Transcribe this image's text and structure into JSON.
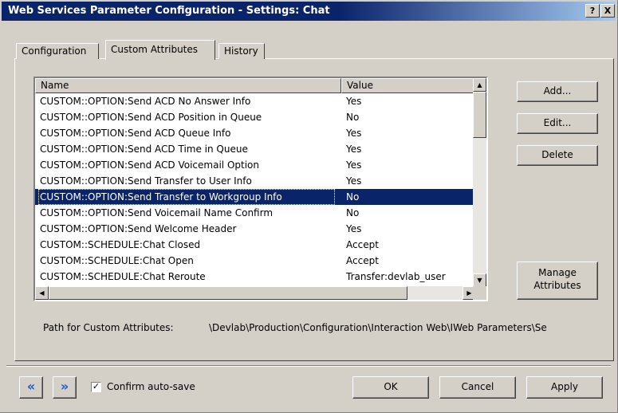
{
  "window": {
    "title": "Web Services Parameter Configuration - Settings: Chat",
    "help_label": "?",
    "close_label": "X"
  },
  "tabs": [
    {
      "label": "Configuration",
      "active": false
    },
    {
      "label": "Custom Attributes",
      "active": true
    },
    {
      "label": "History",
      "active": false
    }
  ],
  "list": {
    "columns": [
      "Name",
      "Value"
    ],
    "rows": [
      {
        "name": "CUSTOM::OPTION:Send ACD No Answer Info",
        "value": "Yes"
      },
      {
        "name": "CUSTOM::OPTION:Send ACD Position in Queue",
        "value": "No"
      },
      {
        "name": "CUSTOM::OPTION:Send ACD Queue Info",
        "value": "Yes"
      },
      {
        "name": "CUSTOM::OPTION:Send ACD Time in Queue",
        "value": "Yes"
      },
      {
        "name": "CUSTOM::OPTION:Send ACD Voicemail Option",
        "value": "Yes"
      },
      {
        "name": "CUSTOM::OPTION:Send Transfer to User Info",
        "value": "Yes"
      },
      {
        "name": "CUSTOM::OPTION:Send Transfer to Workgroup Info",
        "value": "No",
        "selected": true
      },
      {
        "name": "CUSTOM::OPTION:Send Voicemail Name Confirm",
        "value": "No"
      },
      {
        "name": "CUSTOM::OPTION:Send Welcome Header",
        "value": "Yes"
      },
      {
        "name": "CUSTOM::SCHEDULE:Chat Closed",
        "value": "Accept"
      },
      {
        "name": "CUSTOM::SCHEDULE:Chat Open",
        "value": "Accept"
      },
      {
        "name": "CUSTOM::SCHEDULE:Chat Reroute",
        "value": "Transfer:devlab_user"
      }
    ]
  },
  "buttons": {
    "add": "Add...",
    "edit": "Edit...",
    "delete": "Delete",
    "manage_line1": "Manage",
    "manage_line2": "Attributes"
  },
  "path": {
    "label": "Path for Custom Attributes:",
    "value": "\\Devlab\\Production\\Configuration\\Interaction Web\\IWeb Parameters\\Se"
  },
  "footer": {
    "prev_glyph": "«",
    "next_glyph": "»",
    "confirm_label": "Confirm auto-save",
    "confirm_checked": true,
    "check_glyph": "✓",
    "ok": "OK",
    "cancel": "Cancel",
    "apply": "Apply"
  },
  "colors": {
    "title_bar": "#0a246a",
    "selection": "#0a246a",
    "face": "#d4d0c8",
    "nav_arrow": "#1e56c8"
  }
}
